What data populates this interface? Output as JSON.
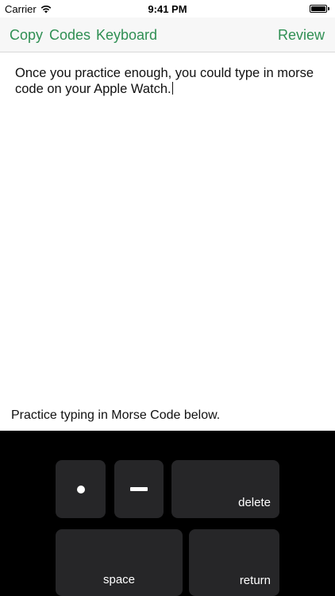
{
  "status_bar": {
    "carrier": "Carrier",
    "time": "9:41 PM",
    "wifi_icon": "wifi-icon",
    "battery_icon": "battery-full-icon"
  },
  "toolbar": {
    "copy_label": "Copy",
    "codes_label": "Codes",
    "keyboard_label": "Keyboard",
    "review_label": "Review",
    "accent_color": "#2f8f53"
  },
  "editor": {
    "text": "Once you practice enough, you could type in morse code on your Apple Watch."
  },
  "hint": "Practice typing in Morse Code below.",
  "keyboard": {
    "dot_icon": "dot-icon",
    "dash_icon": "dash-icon",
    "delete_label": "delete",
    "space_label": "space",
    "return_label": "return",
    "background_color": "#000000",
    "key_color": "#262628"
  }
}
